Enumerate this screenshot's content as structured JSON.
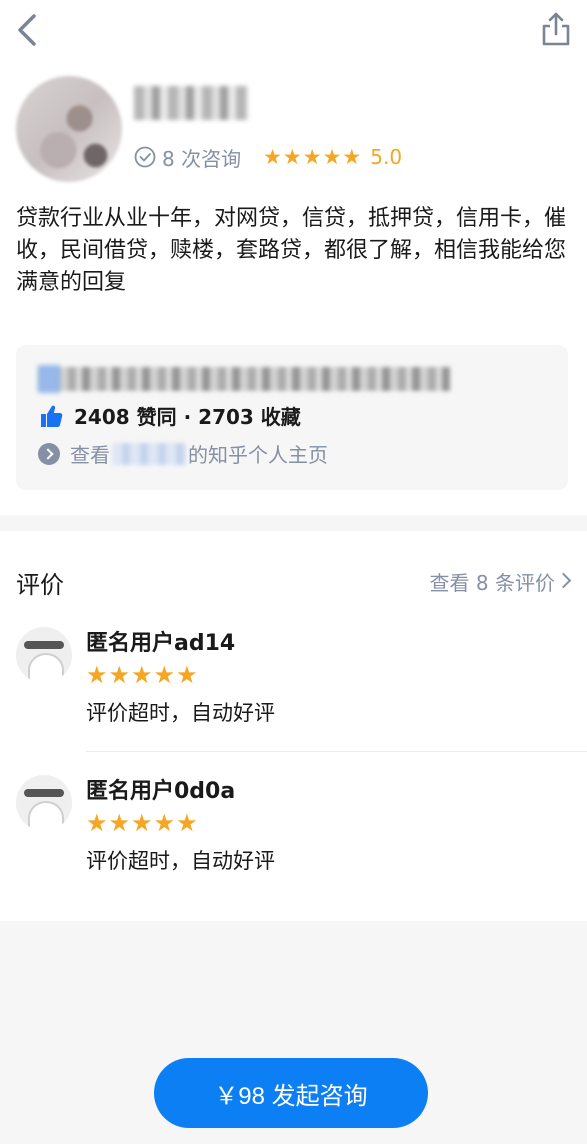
{
  "header": {
    "back_icon": "chevron-left-icon",
    "share_icon": "share-icon"
  },
  "profile": {
    "consult_count": "8 次咨询",
    "rating": "5.0",
    "stars": 5,
    "bio": "贷款行业从业十年，对网贷，信贷，抵押贷，信用卡，催收，民间借贷，赎楼，套路贷，都很了解，相信我能给您满意的回复"
  },
  "card": {
    "likes_text": "2408 赞同 · 2703 收藏",
    "profile_prefix": "查看",
    "profile_suffix": "的知乎个人主页"
  },
  "reviews": {
    "title": "评价",
    "more": "查看 8 条评价",
    "items": [
      {
        "name": "匿名用户ad14",
        "stars": 5,
        "text": "评价超时，自动好评"
      },
      {
        "name": "匿名用户0d0a",
        "stars": 5,
        "text": "评价超时，自动好评"
      }
    ]
  },
  "cta": {
    "label": "￥98 发起咨询"
  },
  "colors": {
    "accent": "#0d7ff5",
    "star": "#f5a623",
    "muted": "#8590a6"
  }
}
